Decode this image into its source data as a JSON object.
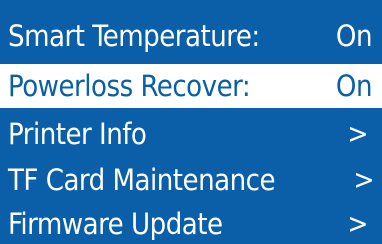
{
  "menu": {
    "items": [
      {
        "label": "Smart Temperature:",
        "value": "On",
        "selected": false
      },
      {
        "label": "Powerloss Recover:",
        "value": "On",
        "selected": true
      },
      {
        "label": "Printer Info",
        "value": ">",
        "selected": false
      },
      {
        "label": "TF Card Maintenance",
        "value": ">",
        "selected": false
      },
      {
        "label": "Firmware Update",
        "value": ">",
        "selected": false
      }
    ]
  },
  "colors": {
    "background": "#0a5fa8",
    "text": "#ffffff",
    "highlight_background": "#ffffff",
    "highlight_text": "#0a5fa8"
  }
}
